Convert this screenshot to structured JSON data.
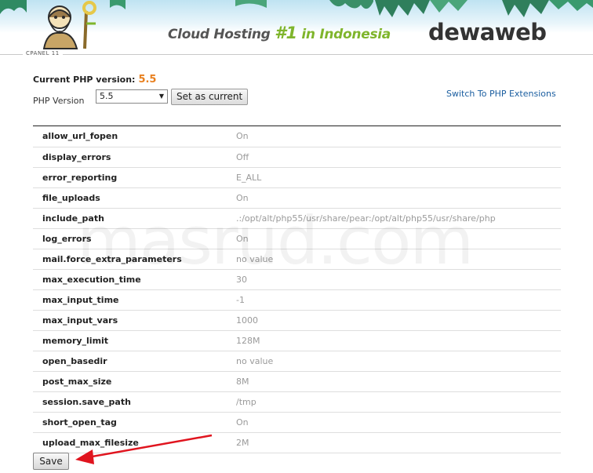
{
  "banner": {
    "tagline_prefix": "Cloud Hosting ",
    "tagline_rank": "#1",
    "tagline_suffix": " in Indonesia",
    "brand": "dewaweb",
    "cpanel_label": "CPANEL 11"
  },
  "selector": {
    "current_label": "Current PHP version:",
    "current_value": "5.5",
    "php_version_label": "PHP Version",
    "selected_version": "5.5",
    "set_button": "Set as current",
    "switch_link": "Switch To PHP Extensions"
  },
  "options": [
    {
      "name": "allow_url_fopen",
      "value": "On"
    },
    {
      "name": "display_errors",
      "value": "Off"
    },
    {
      "name": "error_reporting",
      "value": "E_ALL"
    },
    {
      "name": "file_uploads",
      "value": "On"
    },
    {
      "name": "include_path",
      "value": ".:/opt/alt/php55/usr/share/pear:/opt/alt/php55/usr/share/php"
    },
    {
      "name": "log_errors",
      "value": "On"
    },
    {
      "name": "mail.force_extra_parameters",
      "value": "no value"
    },
    {
      "name": "max_execution_time",
      "value": "30"
    },
    {
      "name": "max_input_time",
      "value": "-1"
    },
    {
      "name": "max_input_vars",
      "value": "1000"
    },
    {
      "name": "memory_limit",
      "value": "128M"
    },
    {
      "name": "open_basedir",
      "value": "no value"
    },
    {
      "name": "post_max_size",
      "value": "8M"
    },
    {
      "name": "session.save_path",
      "value": "/tmp"
    },
    {
      "name": "short_open_tag",
      "value": "On"
    },
    {
      "name": "upload_max_filesize",
      "value": "2M"
    }
  ],
  "save_button": "Save",
  "watermark": "masrud.com",
  "colors": {
    "accent_orange": "#e8801f",
    "brand_green": "#7fb52c",
    "link_blue": "#1b5ea0",
    "annotation_red": "#e0141e"
  }
}
